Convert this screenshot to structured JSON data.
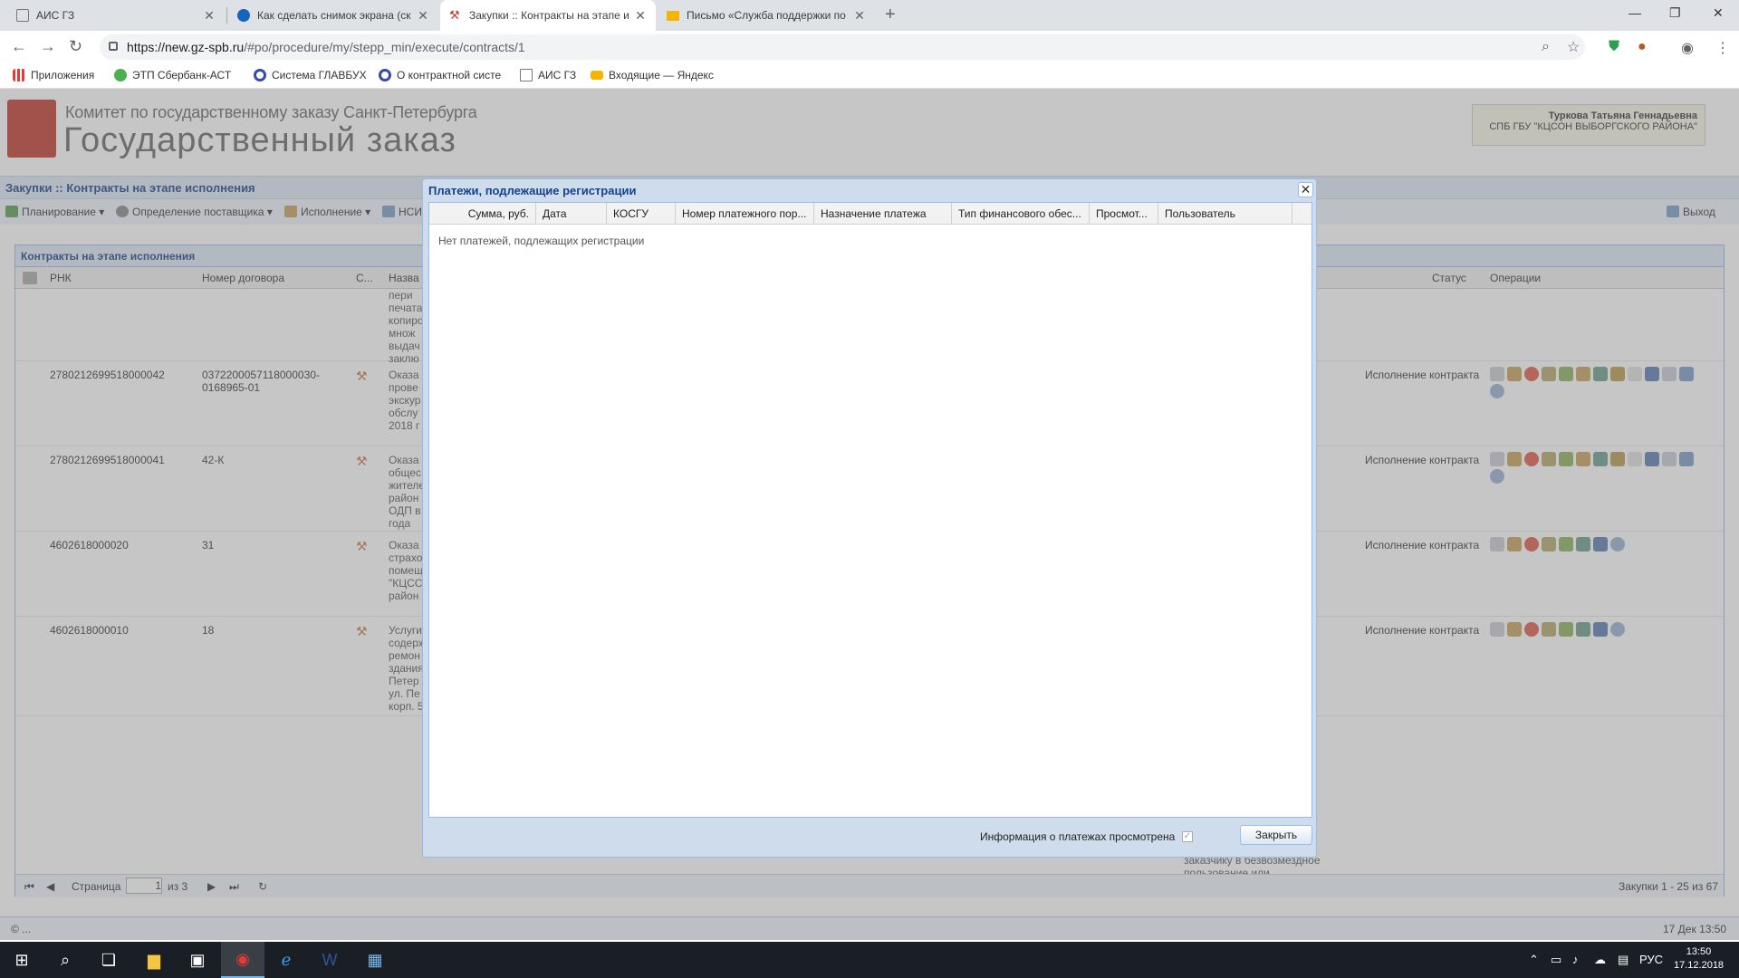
{
  "browser": {
    "tabs": [
      {
        "label": "АИС ГЗ",
        "icon": "page-icon"
      },
      {
        "label": "Как сделать снимок экрана (скр",
        "icon": "globe-icon"
      },
      {
        "label": "Закупки :: Контракты на этапе и",
        "icon": "gavel-icon"
      },
      {
        "label": "Письмо «Служба поддержки по",
        "icon": "mail-icon"
      }
    ],
    "url_prefix": "https://new.gz-spb.ru",
    "url_rest": "/#po/procedure/my/stepp_min/execute/contracts/1",
    "bookmarks": [
      {
        "label": "Приложения",
        "color": "#e53935"
      },
      {
        "label": "ЭТП Сбербанк-АСТ",
        "color": "#4caf50"
      },
      {
        "label": "Система ГЛАВБУХ",
        "color": "#3949ab"
      },
      {
        "label": "О контрактной систе",
        "color": "#3949ab"
      },
      {
        "label": "АИС ГЗ",
        "color": "#888888"
      },
      {
        "label": "Входящие — Яндекс",
        "color": "#f4b400"
      }
    ]
  },
  "header": {
    "org_subtitle": "Комитет по государственному заказу Санкт-Петербурга",
    "org_title": "Государственный заказ",
    "user_name": "Туркова Татьяна Геннадьевна",
    "user_org": "СПБ ГБУ \"КЦСОН ВЫБОРГСКОГО РАЙОНА\""
  },
  "page": {
    "title": "Закупки :: Контракты на этапе исполнения",
    "menu": [
      "Планирование",
      "Определение поставщика",
      "Исполнение",
      "НСИ"
    ],
    "exit_label": "Выход",
    "panel_title": "Контракты на этапе исполнения",
    "columns": {
      "rnk": "РНК",
      "contract_no": "Номер договора",
      "s": "С...",
      "name": "Назва",
      "status": "Статус",
      "ops": "Операции"
    },
    "first_row_name": [
      "пери",
      "печата",
      "копиро",
      "множ",
      "выдач",
      "заклю"
    ],
    "rows": [
      {
        "rnk": "2780212699518000042",
        "contract_no": "0372200057118000030-0168965-01",
        "name": [
          "Оказа",
          "прове",
          "экскур",
          "обслу",
          "2018 г"
        ],
        "status": "Исполнение контракта"
      },
      {
        "rnk": "2780212699518000041",
        "contract_no": "42-К",
        "name": [
          "Оказа",
          "общес",
          "жителе",
          "район",
          "ОДП в",
          "года"
        ],
        "status": "Исполнение контракта"
      },
      {
        "rnk": "4602618000020",
        "contract_no": "31",
        "name": [
          "Оказа",
          "страхо",
          "помещ",
          "\"КЦСС",
          "район"
        ],
        "status": "Исполнение контракта"
      },
      {
        "rnk": "4602618000010",
        "contract_no": "18",
        "name": [
          "Услуги",
          "содерж",
          "ремон",
          "здания",
          "Петер",
          "ул. Пе",
          "корп. 5"
        ],
        "status": "Исполнение контракта"
      }
    ],
    "behind_text": [
      "заказчику в безвозмездное",
      "пользование или"
    ],
    "pager": {
      "page_label": "Страница",
      "page_value": "1",
      "of_label": "из 3",
      "summary": "Закупки 1 - 25 из 67"
    },
    "status_left": "© ...",
    "status_right": "17 Дек 13:50"
  },
  "modal": {
    "title": "Платежи, подлежащие регистрации",
    "columns": [
      "Сумма, руб.",
      "Дата",
      "КОСГУ",
      "Номер платежного пор...",
      "Назначение платежа",
      "Тип финансового обес...",
      "Просмот...",
      "Пользователь"
    ],
    "empty_text": "Нет платежей, подлежащих регистрации",
    "checkbox_label": "Информация о платежах просмотрена",
    "close_button": "Закрыть"
  },
  "taskbar": {
    "lang": "РУС",
    "time": "13:50",
    "date": "17.12.2018"
  },
  "colors": {
    "accent": "#15428b",
    "panel_border": "#99bbe8",
    "header_bg": "#dfe8f5"
  }
}
